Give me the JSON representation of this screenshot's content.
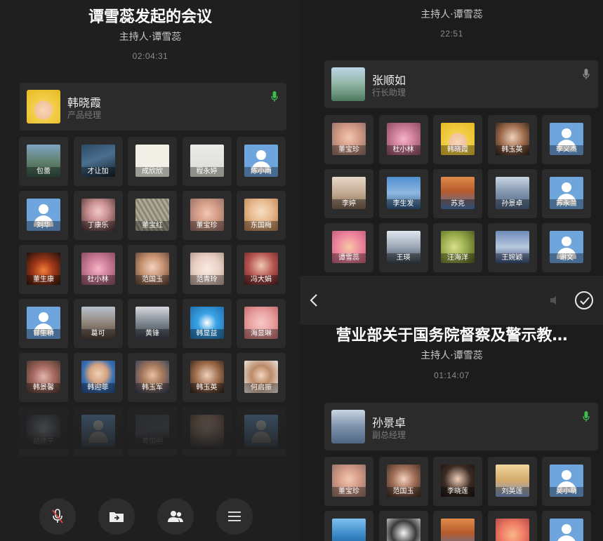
{
  "colors": {
    "background": "#1f1f1f",
    "card": "#2b2b2b",
    "mic_active": "#3cbf4f",
    "default_avatar": "#6ea5dd"
  },
  "left": {
    "meeting_title": "谭雪蕊发起的会议",
    "host": "主持人·谭雪蕊",
    "duration": "02:04:31",
    "active_speaker": {
      "name": "韩晓霞",
      "role": "产品经理",
      "icon": "mic-active-icon"
    },
    "participants": [
      {
        "name": "包蕾",
        "pic": "p-lake"
      },
      {
        "name": "才让加",
        "pic": "p-cliff"
      },
      {
        "name": "成欣欣",
        "pic": "p-doodle"
      },
      {
        "name": "程永婷",
        "pic": "p-plant"
      },
      {
        "name": "陈小雨",
        "pic": "default"
      },
      {
        "name": "刘华",
        "pic": "default"
      },
      {
        "name": "丁康乐",
        "pic": "p-girl-dark"
      },
      {
        "name": "董宝红",
        "pic": "p-grass"
      },
      {
        "name": "董宝珍",
        "pic": "p-baby"
      },
      {
        "name": "东国梅",
        "pic": "p-anime"
      },
      {
        "name": "董生康",
        "pic": "p-fire"
      },
      {
        "name": "杜小林",
        "pic": "p-pig"
      },
      {
        "name": "范国玉",
        "pic": "p-woman"
      },
      {
        "name": "范青玲",
        "pic": "p-panda"
      },
      {
        "name": "冯大娟",
        "pic": "p-anime2"
      },
      {
        "name": "甘生桥",
        "pic": "default"
      },
      {
        "name": "葛可",
        "pic": "p-street"
      },
      {
        "name": "黄锋",
        "pic": "p-sea"
      },
      {
        "name": "韩显益",
        "pic": "p-doraemon"
      },
      {
        "name": "海显琳",
        "pic": "p-pink"
      },
      {
        "name": "韩景馨",
        "pic": "p-flower"
      },
      {
        "name": "韩迎菲",
        "pic": "p-man"
      },
      {
        "name": "韩玉军",
        "pic": "p-man2"
      },
      {
        "name": "韩玉英",
        "pic": "p-woman2"
      },
      {
        "name": "何启振",
        "pic": "p-man3"
      },
      {
        "name": "胡建平",
        "pic": "p-penguin"
      },
      {
        "name": "",
        "pic": "default"
      },
      {
        "name": "黄国明",
        "pic": "p-dusk"
      },
      {
        "name": "",
        "pic": "p-kids"
      },
      {
        "name": "",
        "pic": "default"
      }
    ],
    "controls": [
      {
        "name": "mute-mic-button",
        "icon": "mic-muted-icon"
      },
      {
        "name": "share-screen-button",
        "icon": "share-screen-icon"
      },
      {
        "name": "members-button",
        "icon": "members-icon"
      },
      {
        "name": "more-menu-button",
        "icon": "menu-icon"
      }
    ]
  },
  "right": {
    "top_meeting": {
      "host": "主持人·谭雪蕊",
      "duration": "22:51",
      "active_speaker": {
        "name": "张顺如",
        "role": "行长助理",
        "icon": "mic-idle-icon"
      },
      "participants": [
        {
          "name": "董宝珍",
          "pic": "p-baby"
        },
        {
          "name": "杜小林",
          "pic": "p-pig"
        },
        {
          "name": "韩晓霞",
          "pic": "p-cartoon"
        },
        {
          "name": "韩玉英",
          "pic": "p-woman2"
        },
        {
          "name": "李义杰",
          "pic": "default"
        },
        {
          "name": "李婷",
          "pic": "p-braid"
        },
        {
          "name": "李生发",
          "pic": "p-silhouette"
        },
        {
          "name": "苏克",
          "pic": "p-canyon"
        },
        {
          "name": "孙景卓",
          "pic": "p-mountain"
        },
        {
          "name": "苏永兰",
          "pic": "default"
        },
        {
          "name": "谭雪蕊",
          "pic": "p-fruit"
        },
        {
          "name": "王瑛",
          "pic": "p-penguin2"
        },
        {
          "name": "汪海洋",
          "pic": "p-limes"
        },
        {
          "name": "王婉颖",
          "pic": "p-waves"
        },
        {
          "name": "谢文",
          "pic": "default"
        }
      ]
    },
    "bottom_meeting": {
      "meeting_title": "营业部关于国务院督察及警示教…",
      "host": "主持人·谭雪蕊",
      "duration": "01:14:07",
      "active_speaker": {
        "name": "孙景卓",
        "role": "副总经理",
        "icon": "mic-active-icon"
      },
      "participants": [
        {
          "name": "董宝珍",
          "pic": "p-baby"
        },
        {
          "name": "范国玉",
          "pic": "p-woman3"
        },
        {
          "name": "李晓莲",
          "pic": "p-woman4"
        },
        {
          "name": "刘英莲",
          "pic": "p-family"
        },
        {
          "name": "吴小萌",
          "pic": "default"
        },
        {
          "name": "",
          "pic": "p-sky"
        },
        {
          "name": "",
          "pic": "p-boy"
        },
        {
          "name": "",
          "pic": "p-canyon"
        },
        {
          "name": "",
          "pic": "p-fruit2"
        },
        {
          "name": "",
          "pic": "default"
        }
      ]
    },
    "nav": {
      "back_icon": "chevron-left-icon",
      "confirm_icon": "check-circle-icon",
      "speaker_icon": "speaker-icon"
    }
  }
}
